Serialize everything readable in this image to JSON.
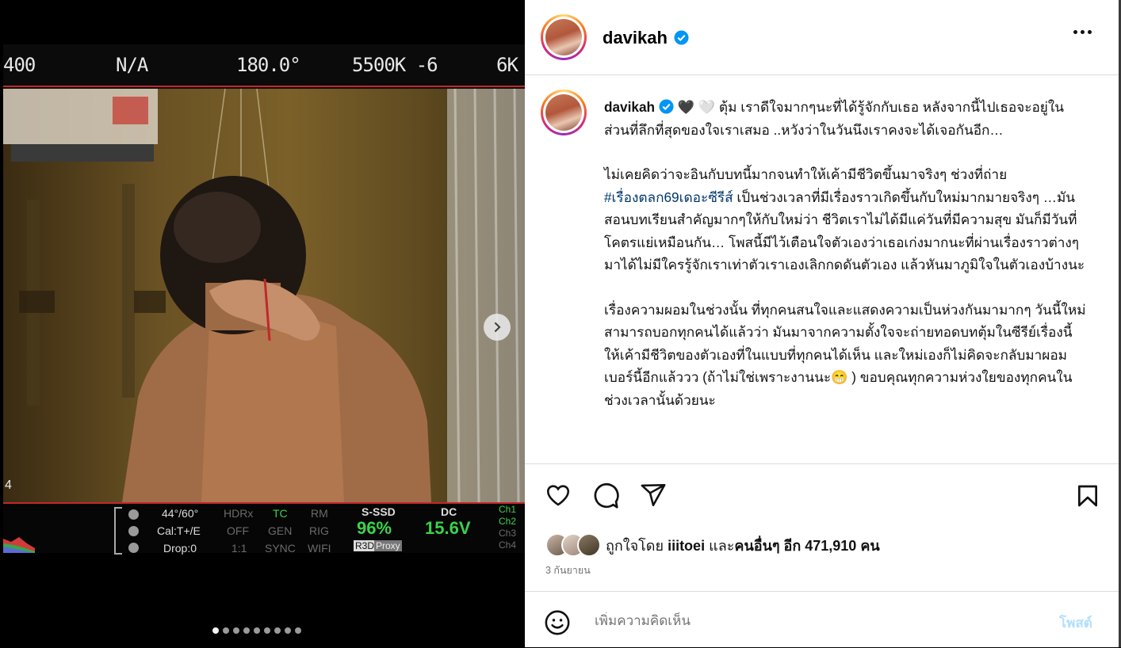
{
  "post": {
    "username": "davikah",
    "caption_paragraphs": [
      [
        "🖤 🤍 ตุ้ม เราดีใจมากๆนะที่ได้รู้จักกับเธอ หลังจากนี้ไปเธอจะอยู่ในส่วนที่ลึกที่สุดของใจเราเสมอ ..หวังว่าในวันนึงเราคงจะได้เจอกันอีก…"
      ],
      [
        "ไม่เคยคิดว่าจะอินกับบทนี้มากจนทำให้เค้ามีชีวิตขึ้นมาจริงๆ ช่วงที่ถ่าย",
        "#เรื่องตลก69เดอะซีรีส์",
        " เป็นช่วงเวลาที่มีเรื่องราวเกิดขึ้นกับใหม่มากมายจริงๆ …มันสอนบทเรียนสำคัญมากๆให้กับใหม่ว่า ชีวิตเราไม่ได้มีแค่วันที่มีความสุข มันก็มีวันที่โคตรแย่เหมือนกัน… โพสนี้มีไว้เตือนใจตัวเองว่าเธอเก่งมากนะที่ผ่านเรื่องราวต่างๆมาได้ไม่มีใครรู้จักเราเท่าตัวเราเองเลิกกดดันตัวเอง แล้วหันมาภูมิใจในตัวเองบ้างนะ"
      ],
      [
        "เรื่องความผอมในช่วงนั้น ที่ทุกคนสนใจและแสดงความเป็นห่วงกันมามากๆ วันนี้ใหม่สามารถบอกทุกคนได้แล้วว่า มันมาจากความตั้งใจจะถ่ายทอดบทตุ้มในซีรีย์เรื่องนี้ให้เค้ามีชีวิตของตัวเองที่ในแบบที่ทุกคนได้เห็น และใหม่เองก็ไม่คิดจะกลับมาผอมเบอร์นี้อีกแล้ววว (ถ้าไม่ใช่เพราะงานนะ😁 ) ขอบคุณทุกความห่วงใยของทุกคนในช่วงเวลานั้นด้วยนะ"
      ]
    ],
    "likes_prefix": "ถูกใจโดย",
    "likes_user": "iiitoei",
    "likes_and": "และ",
    "likes_others": "คนอื่นๆ อีก 471,910 คน",
    "date": "3 กันยายน",
    "comment_placeholder": "เพิ่มความคิดเห็น",
    "post_button": "โพสต์"
  },
  "media": {
    "carousel_count": 9,
    "carousel_active_index": 0,
    "camera_top": [
      "400",
      "N/A",
      "180.0°",
      "5500K -6",
      "6K"
    ],
    "camera_bottom": {
      "angle": "44°/60°",
      "cal": "Cal:T+/E",
      "drop": "Drop:0",
      "hdrx": "HDRx",
      "off": "OFF",
      "ratio": "1:1",
      "tc": "TC",
      "gen": "GEN",
      "sync": "SYNC",
      "rm": "RM",
      "rig": "RIG",
      "wifi": "WIFI",
      "ssd_label": "S-SSD",
      "ssd_value": "96%",
      "r3d": "R3D",
      "proxy": "Proxy",
      "dc_label": "DC",
      "dc_value": "15.6V",
      "channels": [
        "Ch1",
        "Ch2",
        "Ch3",
        "Ch4"
      ],
      "corner": "4"
    }
  },
  "colors": {
    "accent_link": "#00376b",
    "post_button_disabled": "#b2dffc",
    "verified": "#0095f6",
    "camera_green": "#3ad34a",
    "camera_red_line": "#c2272d"
  }
}
